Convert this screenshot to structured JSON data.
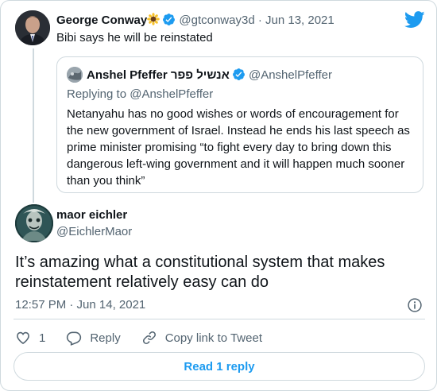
{
  "parent_tweet": {
    "name": "George Conway",
    "emoji": "sunflower",
    "handle": "@gtconway3d",
    "separator": "·",
    "date": "Jun 13, 2021",
    "text": "Bibi says he will be reinstated"
  },
  "quoted_tweet": {
    "name": "Anshel Pfeffer אנשיל פפר",
    "handle": "@AnshelPfeffer",
    "reply_prefix": "Replying to",
    "reply_to": "@AnshelPfeffer",
    "text": "Netanyahu has no good wishes or words of encouragement for the new government of Israel. Instead he ends his last speech as prime minister promising “to fight every day to bring down this dangerous left-wing government and it will happen much sooner than you think”"
  },
  "main_tweet": {
    "name": "maor eichler",
    "handle": "@EichlerMaor",
    "text": "It’s amazing what a constitutional system that makes reinstatement relatively easy can do",
    "timestamp": "12:57 PM · Jun 14, 2021"
  },
  "actions": {
    "like_count": "1",
    "reply_label": "Reply",
    "copy_link_label": "Copy link to Tweet"
  },
  "read_replies_label": "Read 1 reply",
  "colors": {
    "accent": "#1d9bf0",
    "text": "#0f1419",
    "muted": "#536471",
    "border": "#cfd9de"
  },
  "icons": [
    "twitter-logo-icon",
    "verified-badge-icon",
    "sunflower-emoji-icon",
    "info-icon",
    "heart-icon",
    "reply-bubble-icon",
    "link-icon"
  ]
}
